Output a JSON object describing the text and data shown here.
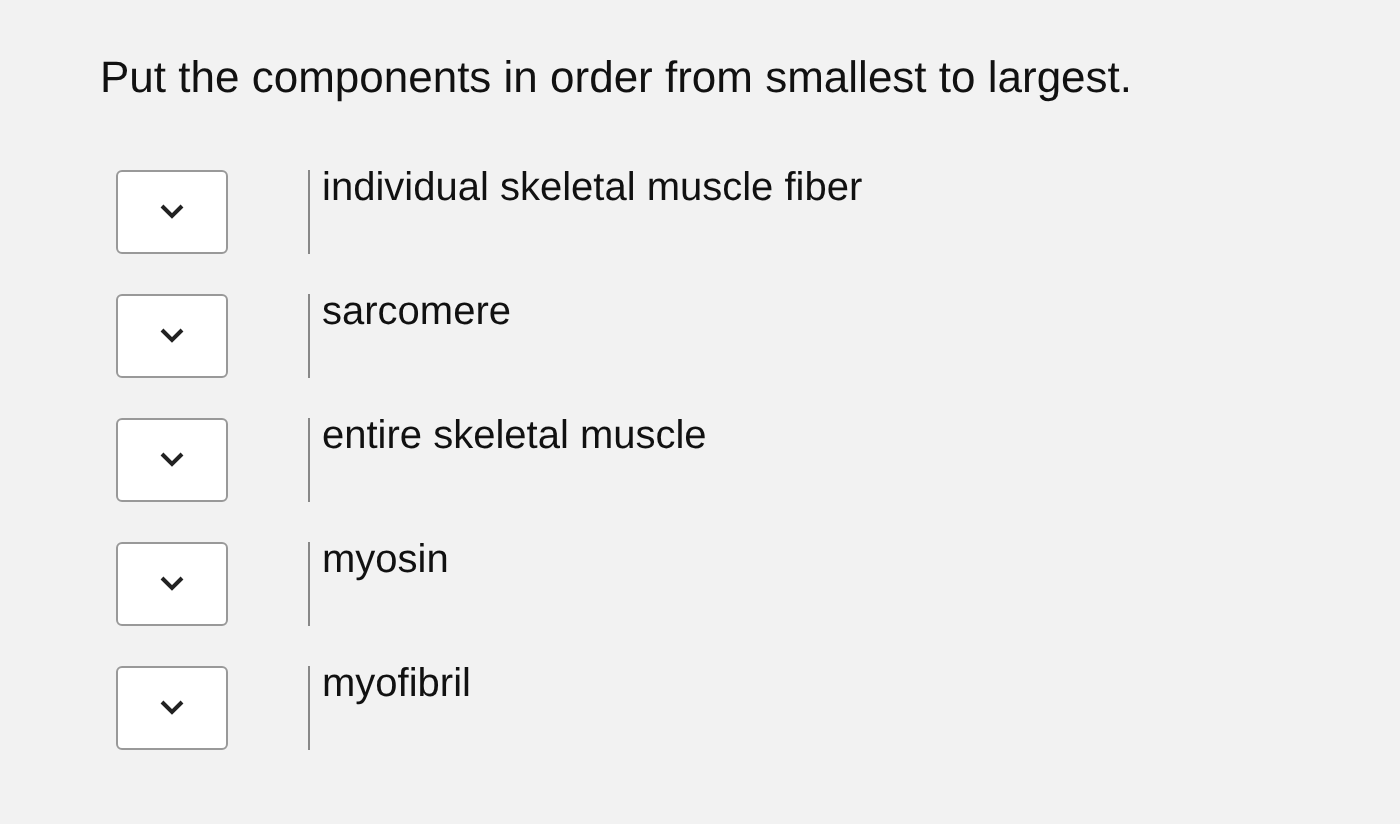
{
  "prompt": "Put the components in order from smallest to largest.",
  "items": [
    {
      "label": "individual skeletal muscle fiber"
    },
    {
      "label": "sarcomere"
    },
    {
      "label": "entire skeletal muscle"
    },
    {
      "label": "myosin"
    },
    {
      "label": "myofibril"
    }
  ]
}
